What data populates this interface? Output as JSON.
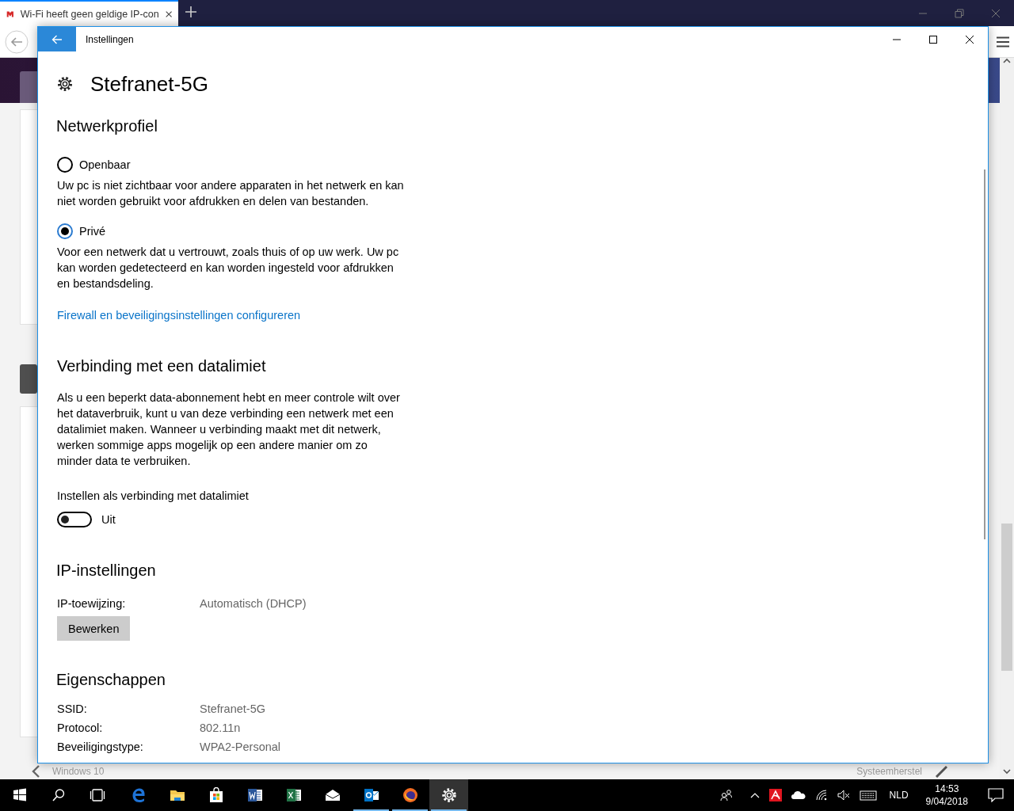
{
  "browser": {
    "tab": {
      "title": "Wi-Fi heeft geen geldige IP-con"
    },
    "footer": {
      "left": "Windows 10",
      "right": "Systeemherstel"
    }
  },
  "settings": {
    "window_title": "Instellingen",
    "page_title": "Stefranet-5G",
    "network_profile": {
      "heading": "Netwerkprofiel",
      "options": [
        {
          "label": "Openbaar",
          "description": "Uw pc is niet zichtbaar voor andere apparaten in het netwerk en kan niet worden gebruikt voor afdrukken en delen van bestanden.",
          "selected": false
        },
        {
          "label": "Privé",
          "description": "Voor een netwerk dat u vertrouwt, zoals thuis of op uw werk. Uw pc kan worden gedetecteerd en kan worden ingesteld voor afdrukken en bestandsdeling.",
          "selected": true
        }
      ],
      "link": "Firewall en beveiligingsinstellingen configureren"
    },
    "metered": {
      "heading": "Verbinding met een datalimiet",
      "description": "Als u een beperkt data-abonnement hebt en meer controle wilt over het dataverbruik, kunt u van deze verbinding een netwerk met een datalimiet maken. Wanneer u verbinding maakt met dit netwerk, werken sommige apps mogelijk op een andere manier om zo minder data te verbruiken.",
      "toggle_label": "Instellen als verbinding met datalimiet",
      "toggle": {
        "on": false,
        "state_text": "Uit"
      }
    },
    "ip_settings": {
      "heading": "IP-instellingen",
      "rows": [
        {
          "label": "IP-toewijzing:",
          "value": "Automatisch (DHCP)"
        }
      ],
      "button": "Bewerken"
    },
    "properties": {
      "heading": "Eigenschappen",
      "rows": [
        {
          "label": "SSID:",
          "value": "Stefranet-5G"
        },
        {
          "label": "Protocol:",
          "value": "802.11n"
        },
        {
          "label": "Beveiligingstype:",
          "value": "WPA2-Personal"
        }
      ]
    }
  },
  "taskbar": {
    "buttons": [
      {
        "kind": "start"
      },
      {
        "kind": "search"
      },
      {
        "kind": "taskview"
      }
    ],
    "apps": [
      {
        "kind": "edge",
        "running": false,
        "active": false
      },
      {
        "kind": "explorer",
        "running": false,
        "active": false
      },
      {
        "kind": "store",
        "running": false,
        "active": false
      },
      {
        "kind": "word",
        "running": false,
        "active": false
      },
      {
        "kind": "excel",
        "running": false,
        "active": false
      },
      {
        "kind": "mail",
        "running": false,
        "active": false
      },
      {
        "kind": "outlook",
        "running": true,
        "active": false
      },
      {
        "kind": "firefox",
        "running": true,
        "active": false
      },
      {
        "kind": "settings",
        "running": true,
        "active": true
      }
    ],
    "tray": {
      "language": "NLD",
      "time": "14:53",
      "date": "9/04/2018"
    }
  }
}
